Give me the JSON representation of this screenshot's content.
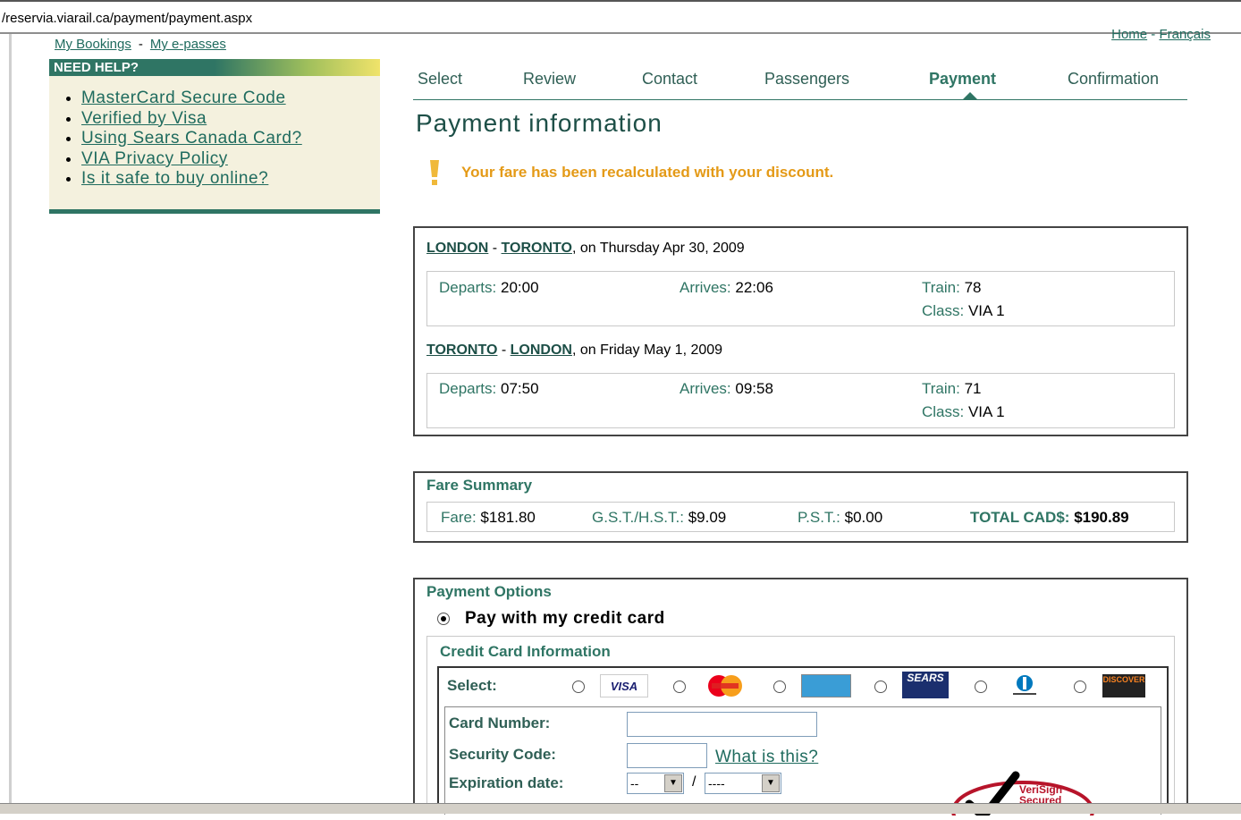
{
  "address": "/reservia.viarail.ca/payment/payment.aspx",
  "top_links": {
    "my_bookings": "My Bookings",
    "sep": "-",
    "my_epasses": "My e-passes"
  },
  "home_links": {
    "home": "Home",
    "sep": "-",
    "francais": "Français"
  },
  "help": {
    "title": "NEED HELP?",
    "items": [
      "MasterCard Secure Code",
      "Verified by Visa",
      "Using Sears Canada Card?",
      "VIA Privacy Policy",
      "Is it safe to buy online?"
    ]
  },
  "steps": [
    "Select",
    "Review",
    "Contact",
    "Passengers",
    "Payment",
    "Confirmation"
  ],
  "page_title": "Payment information",
  "warning": "Your fare has been recalculated with your discount.",
  "trips": [
    {
      "from": "LONDON",
      "to": "TORONTO",
      "date": ", on Thursday Apr 30, 2009",
      "departs_label": "Departs:",
      "departs": "20:00",
      "arrives_label": "Arrives:",
      "arrives": "22:06",
      "train_label": "Train:",
      "train": "78",
      "class_label": "Class:",
      "class": "VIA 1"
    },
    {
      "from": "TORONTO",
      "to": "LONDON",
      "date": ", on Friday May 1, 2009",
      "departs_label": "Departs:",
      "departs": "07:50",
      "arrives_label": "Arrives:",
      "arrives": "09:58",
      "train_label": "Train:",
      "train": "71",
      "class_label": "Class:",
      "class": "VIA 1"
    }
  ],
  "fare": {
    "title": "Fare Summary",
    "fare_label": "Fare:",
    "fare": "$181.80",
    "gst_label": "G.S.T./H.S.T.:",
    "gst": "$9.09",
    "pst_label": "P.S.T.:",
    "pst": "$0.00",
    "total_label": "TOTAL CAD$:",
    "total": "$190.89"
  },
  "payment": {
    "title": "Payment Options",
    "pay_credit": "Pay with my credit card",
    "cc_title": "Credit Card Information",
    "select_label": "Select:",
    "cards": [
      "VISA",
      "MasterCard",
      "AMEX",
      "SEARS",
      "Diners Club",
      "DISCOVER"
    ],
    "card_number_label": "Card Number:",
    "security_label": "Security Code:",
    "what_is_this": "What is this?",
    "expiration_label": "Expiration date:",
    "month_value": "--",
    "year_value": "----",
    "slash": "/",
    "verisign": "VeriSign Secured"
  },
  "colors": {
    "brand": "#2f7564",
    "warning": "#e49a17"
  }
}
